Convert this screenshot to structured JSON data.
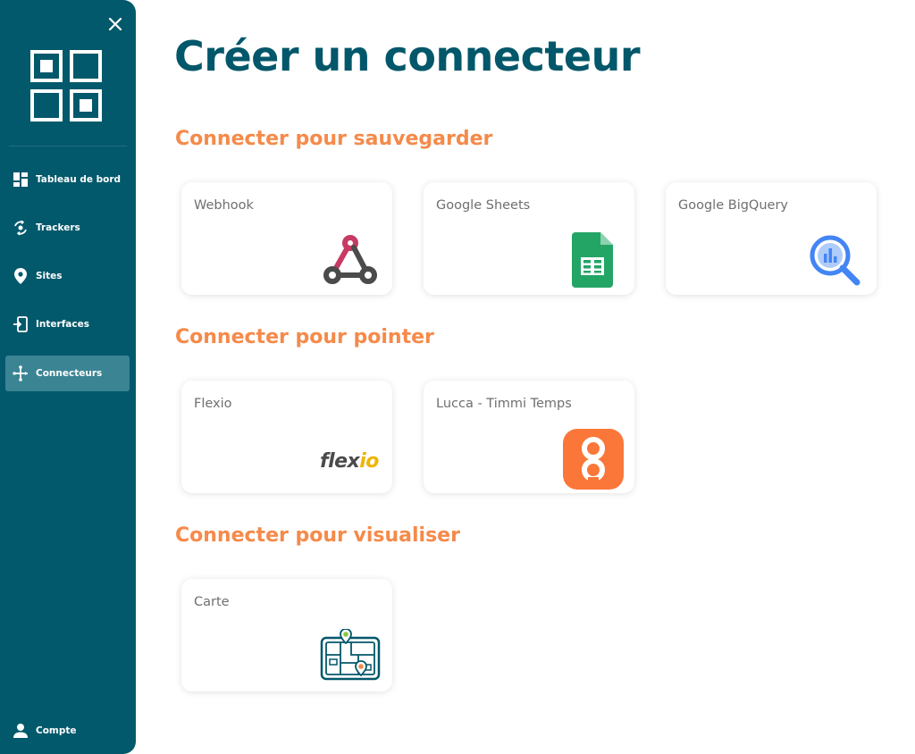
{
  "sidebar": {
    "items": [
      {
        "label": "Tableau de bord",
        "icon": "dashboard-icon"
      },
      {
        "label": "Trackers",
        "icon": "tracker-icon"
      },
      {
        "label": "Sites",
        "icon": "location-pin-icon"
      },
      {
        "label": "Interfaces",
        "icon": "interface-icon"
      },
      {
        "label": "Connecteurs",
        "icon": "connector-icon",
        "active": true
      }
    ],
    "account_label": "Compte"
  },
  "page": {
    "title": "Créer un connecteur"
  },
  "sections": [
    {
      "title": "Connecter pour sauvegarder",
      "cards": [
        {
          "label": "Webhook",
          "icon": "webhook-icon"
        },
        {
          "label": "Google Sheets",
          "icon": "google-sheets-icon"
        },
        {
          "label": "Google BigQuery",
          "icon": "google-bigquery-icon"
        }
      ]
    },
    {
      "title": "Connecter pour pointer",
      "cards": [
        {
          "label": "Flexio",
          "icon": "flexio-logo",
          "logo_text": "flexio"
        },
        {
          "label": "Lucca - Timmi Temps",
          "icon": "lucca-timmi-icon"
        }
      ]
    },
    {
      "title": "Connecter pour visualiser",
      "cards": [
        {
          "label": "Carte",
          "icon": "map-icon"
        }
      ]
    }
  ],
  "colors": {
    "sidebar": "#02596b",
    "sidebar_active": "#3b8494",
    "title": "#03576a",
    "section_title": "#f58a4a"
  }
}
